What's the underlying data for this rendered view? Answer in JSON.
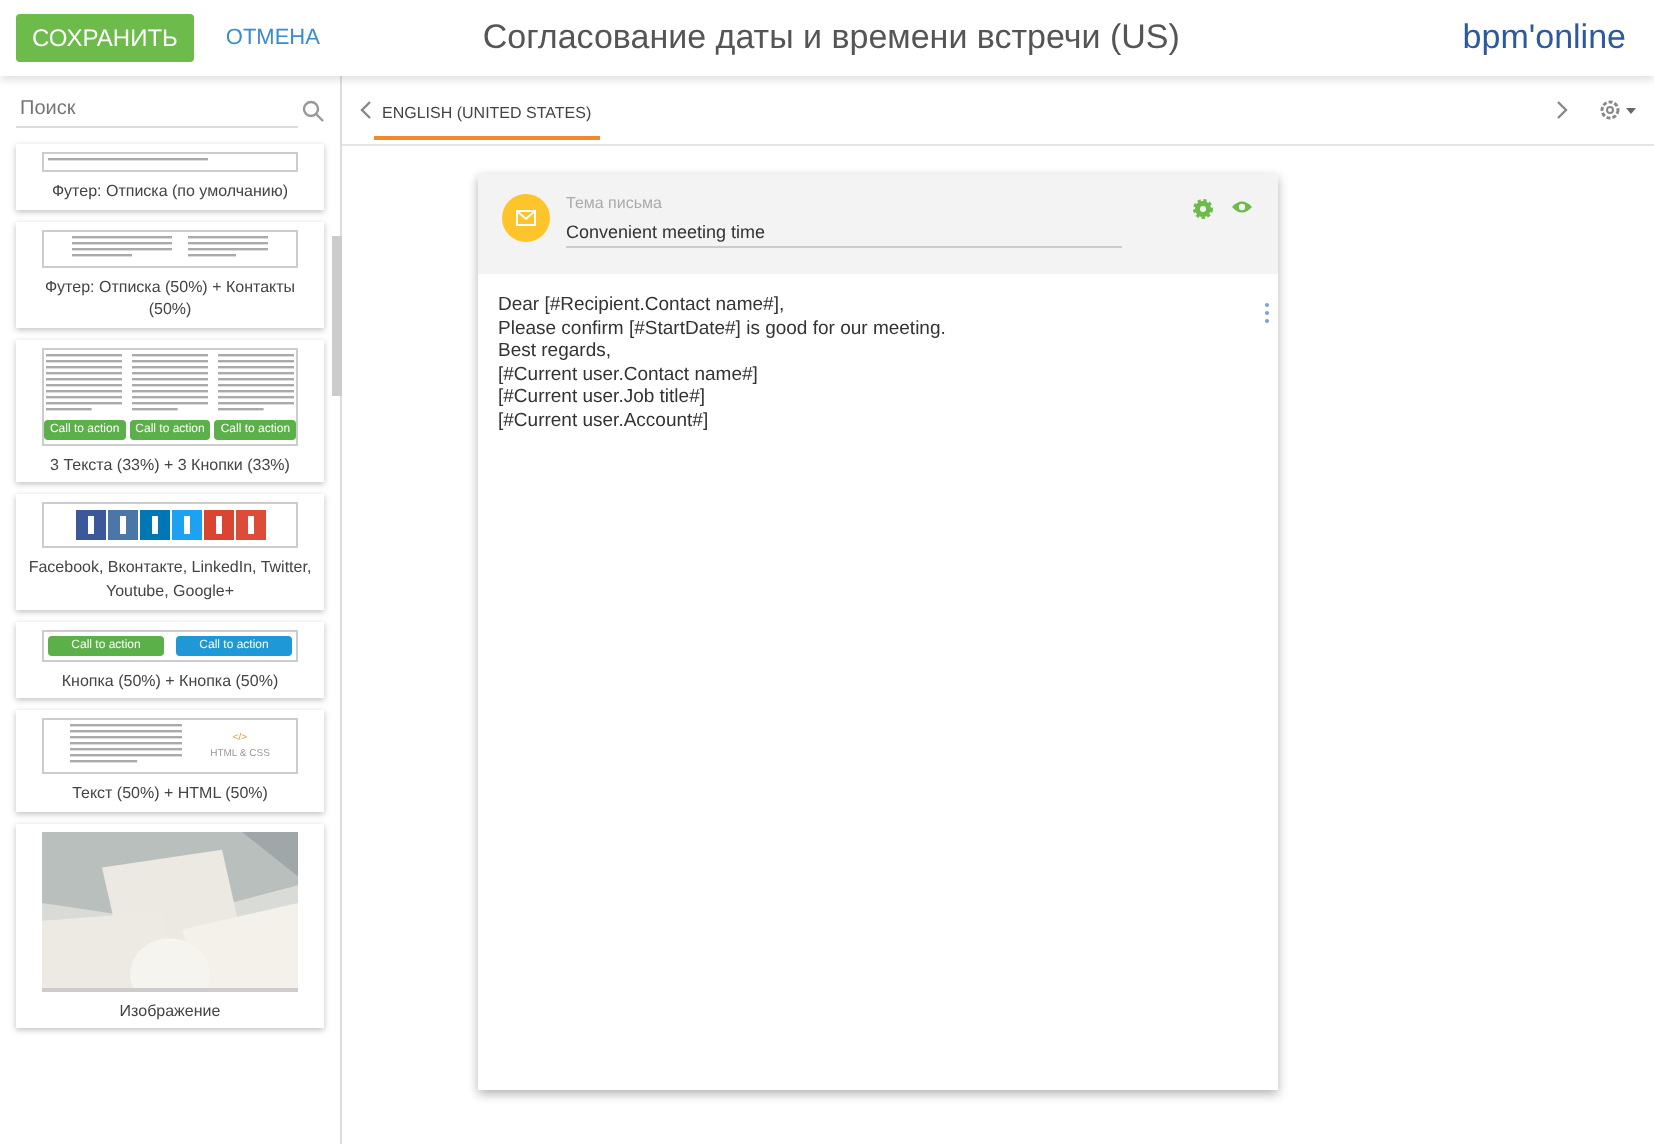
{
  "header": {
    "save_button": "СОХРАНИТЬ",
    "cancel_link": "ОТМЕНА",
    "title": "Согласование даты и времени встречи (US)",
    "logo": "bpm'online"
  },
  "sidebar": {
    "search": {
      "placeholder": "Поиск"
    },
    "blocks": [
      {
        "kind": "footer",
        "caption": "Футер: Отписка (по умолчанию)"
      },
      {
        "kind": "footer_contacts",
        "caption": "Футер: Отписка (50%) + Контакты (50%)"
      },
      {
        "kind": "three_text",
        "caption": "3 Текста (33%) + 3 Кнопки (33%)",
        "buttons": [
          "Call to action",
          "Call to action",
          "Call to action"
        ]
      },
      {
        "kind": "social",
        "caption": "Facebook, Вконтакте, LinkedIn, Twitter, Youtube, Google+"
      },
      {
        "kind": "two_buttons",
        "caption": "Кнопка (50%) + Кнопка (50%)",
        "buttons": [
          {
            "label": "Call to action",
            "color": "#5cb04a"
          },
          {
            "label": "Call to action",
            "color": "#1e98d7"
          }
        ]
      },
      {
        "kind": "text_html",
        "caption": "Текст (50%) + HTML (50%)",
        "code_mark": "</>",
        "code_label": "HTML & CSS"
      },
      {
        "caption": "Изображение"
      }
    ]
  },
  "tabs": [
    {
      "label": "ENGLISH (UNITED STATES)",
      "selected": true
    }
  ],
  "editor": {
    "subject_label": "Тема письма",
    "subject": "Convenient meeting time",
    "body": [
      "Dear [#Recipient.Contact name#],",
      "Please confirm [#StartDate#] is good for our meeting.",
      "Best regards,",
      "[#Current user.Contact name#]",
      "[#Current user.Job title#]",
      "[#Current user.Account#]"
    ]
  }
}
